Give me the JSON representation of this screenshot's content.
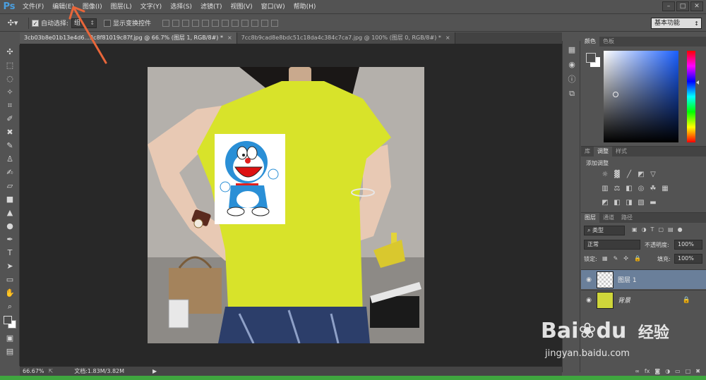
{
  "app": {
    "logo": "Ps"
  },
  "menu": [
    "文件(F)",
    "编辑(E)",
    "图像(I)",
    "图层(L)",
    "文字(Y)",
    "选择(S)",
    "滤镜(T)",
    "视图(V)",
    "窗口(W)",
    "帮助(H)"
  ],
  "window_controls": [
    "–",
    "□",
    "✕"
  ],
  "options": {
    "auto_select_label": "自动选择:",
    "auto_select_value": "组",
    "show_transform_label": "显示变换控件",
    "workspace": "基本功能"
  },
  "tabs": [
    {
      "label": "3cb03b8e01b13e4d6...3c8f81019c87f.jpg @ 66.7% (图层 1, RGB/8#) *",
      "close": "×"
    },
    {
      "label": "7cc8b9cad8e8bdc51c18da4c384c7ca7.jpg @ 100% (图层 0, RGB/8#) *",
      "close": "×"
    }
  ],
  "status": {
    "zoom": "66.67%",
    "doc": "文档:1.83M/3.82M"
  },
  "panels": {
    "color_tabs": [
      "颜色",
      "色板"
    ],
    "adjust_tabs": [
      "库",
      "调整",
      "样式"
    ],
    "adjust_title": "添加调整",
    "layers_tabs": [
      "图层",
      "通道",
      "路径"
    ],
    "kind_filter": "⌕ 类型",
    "blend_mode": "正常",
    "opacity_label": "不透明度:",
    "opacity_value": "100%",
    "lock_label": "锁定:",
    "fill_label": "填充:",
    "fill_value": "100%",
    "layers": [
      {
        "name": "图层 1",
        "selected": true
      },
      {
        "name": "背景",
        "selected": false
      }
    ]
  },
  "watermark": {
    "brand": "Bai",
    "brand2": "du",
    "site_cn": "经验",
    "url": "jingyan.baidu.com"
  },
  "colors": {
    "accent": "#4a9fdf",
    "shirt": "#d8e32a",
    "selected_layer": "#6a7f9a"
  },
  "icons": [
    "move-icon",
    "marquee-icon",
    "lasso-icon",
    "magic-wand-icon",
    "crop-icon",
    "eyedropper-icon",
    "healing-brush-icon",
    "brush-icon",
    "stamp-icon",
    "history-brush-icon",
    "eraser-icon",
    "gradient-icon",
    "blur-icon",
    "dodge-icon",
    "pen-icon",
    "type-icon",
    "path-select-icon",
    "rectangle-icon",
    "hand-icon",
    "zoom-icon"
  ]
}
